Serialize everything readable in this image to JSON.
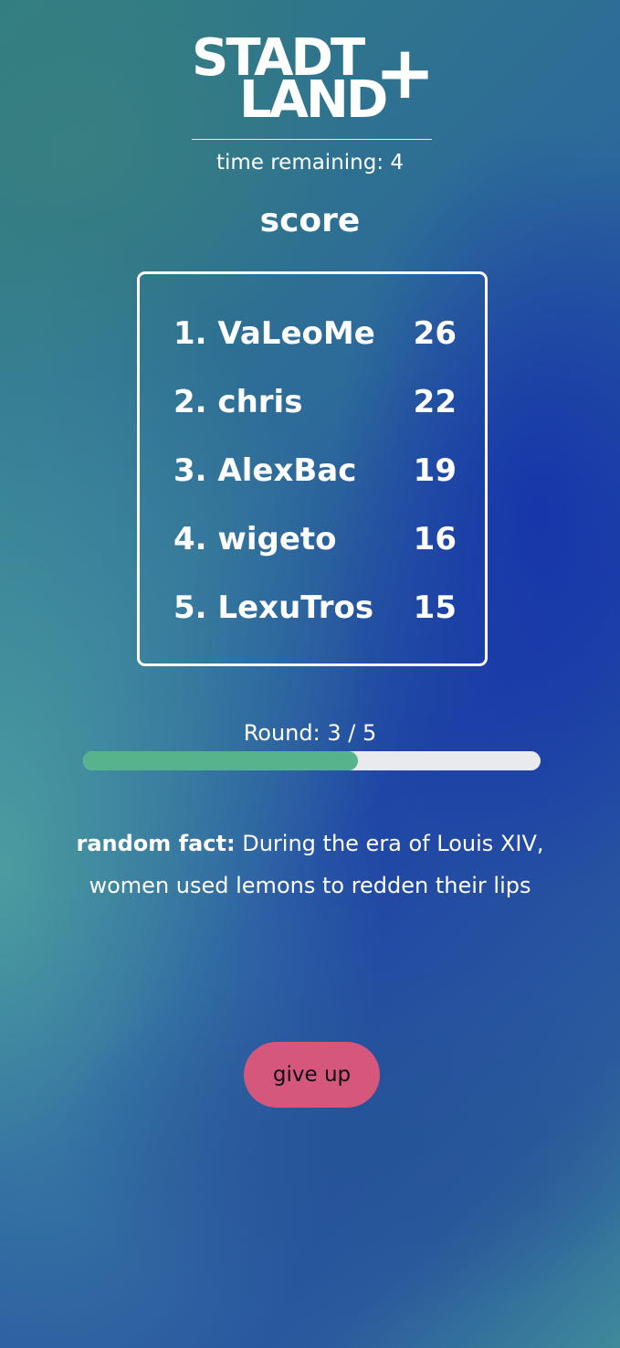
{
  "logo": {
    "line1": "STADT",
    "line2": "LAND",
    "plus": "+"
  },
  "timer": {
    "label": "time remaining:",
    "value": "4"
  },
  "score_title": "score",
  "scoreboard": [
    {
      "rank_name": "1. VaLeoMe",
      "points": "26"
    },
    {
      "rank_name": "2. chris",
      "points": "22"
    },
    {
      "rank_name": "3. AlexBac",
      "points": "19"
    },
    {
      "rank_name": "4. wigeto",
      "points": "16"
    },
    {
      "rank_name": "5. LexuTros",
      "points": "15"
    }
  ],
  "round": {
    "label": "Round:",
    "current": "3",
    "separator": "/",
    "total": "5",
    "progress_fraction": 0.6
  },
  "fact": {
    "label": "random fact:",
    "text": "During the era of Louis XIV, women used lemons to redden their lips"
  },
  "give_up_label": "give up",
  "colors": {
    "progress_fill": "#56b38c",
    "progress_track": "#e9eaee",
    "give_up_button": "#d5577c"
  }
}
